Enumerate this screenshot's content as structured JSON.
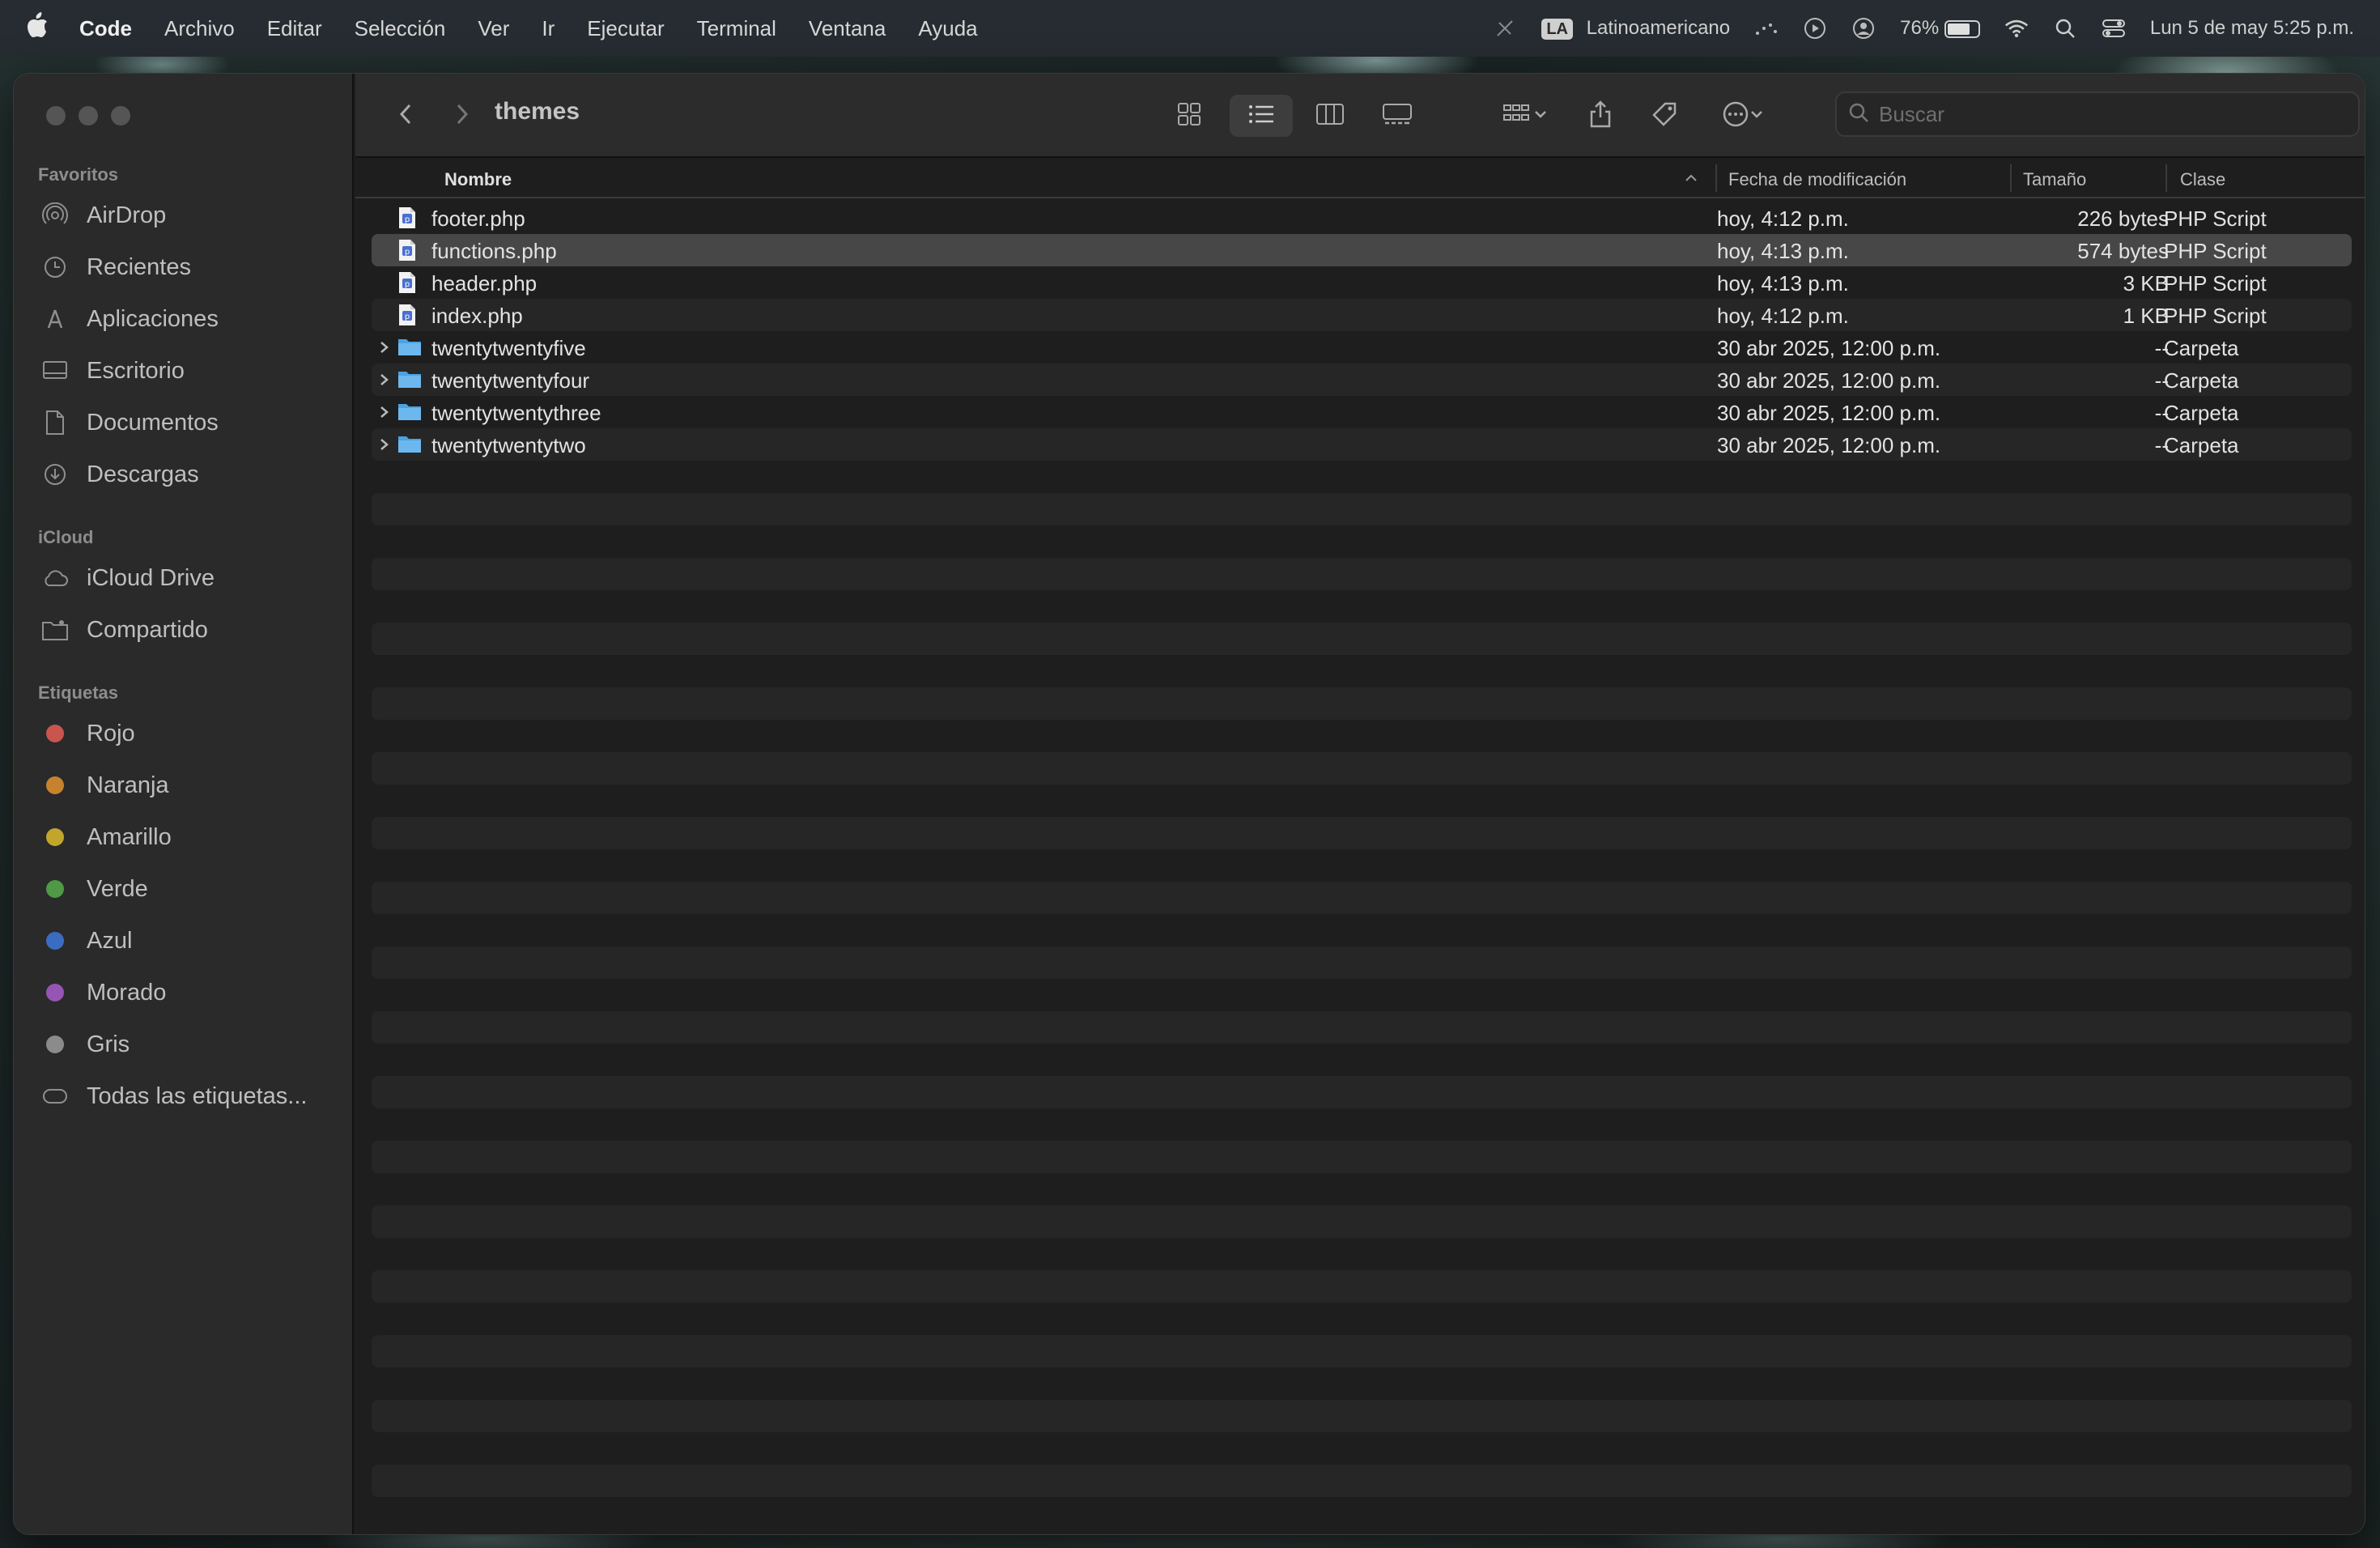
{
  "menubar": {
    "app_name": "Code",
    "items": [
      "Archivo",
      "Editar",
      "Selección",
      "Ver",
      "Ir",
      "Ejecutar",
      "Terminal",
      "Ventana",
      "Ayuda"
    ],
    "keyboard_badge": "LA",
    "keyboard_layout": "Latinoamericano",
    "battery_percent": "76%",
    "battery_level": 0.76,
    "datetime": "Lun 5 de may  5:25 p.m."
  },
  "window": {
    "title": "themes",
    "search_placeholder": "Buscar"
  },
  "sidebar": {
    "favorites_label": "Favoritos",
    "favorites": [
      {
        "label": "AirDrop",
        "icon": "airdrop-icon"
      },
      {
        "label": "Recientes",
        "icon": "clock-icon"
      },
      {
        "label": "Aplicaciones",
        "icon": "applications-icon"
      },
      {
        "label": "Escritorio",
        "icon": "desktop-icon"
      },
      {
        "label": "Documentos",
        "icon": "document-icon"
      },
      {
        "label": "Descargas",
        "icon": "download-icon"
      }
    ],
    "icloud_label": "iCloud",
    "icloud": [
      {
        "label": "iCloud Drive",
        "icon": "cloud-icon"
      },
      {
        "label": "Compartido",
        "icon": "shared-folder-icon"
      }
    ],
    "tags_label": "Etiquetas",
    "tags": [
      {
        "label": "Rojo",
        "color": "#c9554e"
      },
      {
        "label": "Naranja",
        "color": "#c6822e"
      },
      {
        "label": "Amarillo",
        "color": "#c2a62c"
      },
      {
        "label": "Verde",
        "color": "#4f9a45"
      },
      {
        "label": "Azul",
        "color": "#3a6dbf"
      },
      {
        "label": "Morado",
        "color": "#9654b3"
      },
      {
        "label": "Gris",
        "color": "#8b8b8b"
      }
    ],
    "all_tags_label": "Todas las etiquetas..."
  },
  "columns": {
    "name": "Nombre",
    "date": "Fecha de modificación",
    "size": "Tamaño",
    "kind": "Clase"
  },
  "files": [
    {
      "name": "footer.php",
      "date": "hoy, 4:12 p.m.",
      "size": "226 bytes",
      "kind": "PHP Script",
      "type": "file"
    },
    {
      "name": "functions.php",
      "date": "hoy, 4:13 p.m.",
      "size": "574 bytes",
      "kind": "PHP Script",
      "type": "file"
    },
    {
      "name": "header.php",
      "date": "hoy, 4:13 p.m.",
      "size": "3 KB",
      "kind": "PHP Script",
      "type": "file"
    },
    {
      "name": "index.php",
      "date": "hoy, 4:12 p.m.",
      "size": "1 KB",
      "kind": "PHP Script",
      "type": "file"
    },
    {
      "name": "twentytwentyfive",
      "date": "30 abr 2025, 12:00 p.m.",
      "size": "--",
      "kind": "Carpeta",
      "type": "folder"
    },
    {
      "name": "twentytwentyfour",
      "date": "30 abr 2025, 12:00 p.m.",
      "size": "--",
      "kind": "Carpeta",
      "type": "folder"
    },
    {
      "name": "twentytwentythree",
      "date": "30 abr 2025, 12:00 p.m.",
      "size": "--",
      "kind": "Carpeta",
      "type": "folder"
    },
    {
      "name": "twentytwentytwo",
      "date": "30 abr 2025, 12:00 p.m.",
      "size": "--",
      "kind": "Carpeta",
      "type": "folder"
    }
  ],
  "selected_file": "functions.php",
  "colors": {
    "folder_blue": "#4aa3e0",
    "selection": "#474747"
  }
}
